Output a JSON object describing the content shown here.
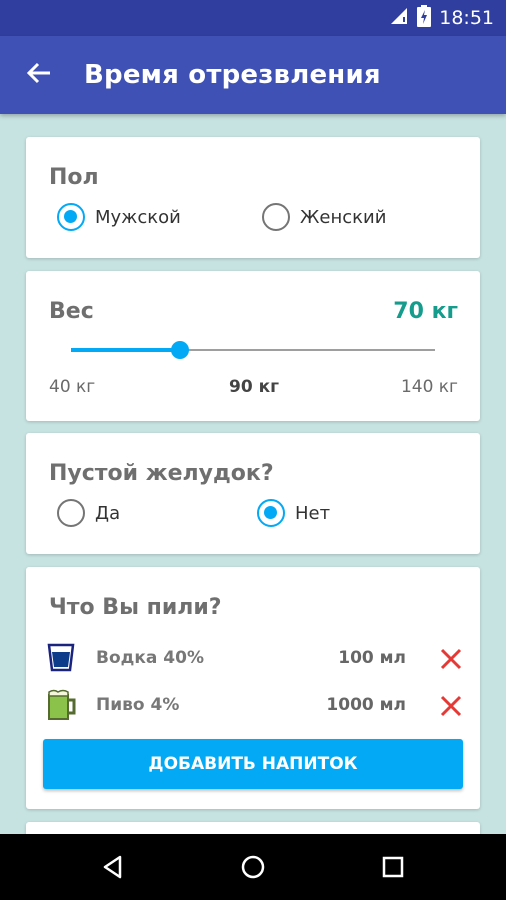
{
  "status_bar": {
    "time": "18:51"
  },
  "app_bar": {
    "title": "Время отрезвления",
    "back_icon": "arrow-back-icon"
  },
  "gender": {
    "title": "Пол",
    "options": [
      {
        "label": "Мужской",
        "checked": true
      },
      {
        "label": "Женский",
        "checked": false
      }
    ]
  },
  "weight": {
    "title": "Вес",
    "value_label": "70 кг",
    "value": 70,
    "min": 40,
    "max": 140,
    "ticks": [
      "40 кг",
      "90 кг",
      "140 кг"
    ]
  },
  "stomach": {
    "title": "Пустой желудок?",
    "options": [
      {
        "label": "Да",
        "checked": false
      },
      {
        "label": "Нет",
        "checked": true
      }
    ]
  },
  "drinks": {
    "title": "Что Вы пили?",
    "items": [
      {
        "name": "Водка 40%",
        "amount": "100 мл",
        "icon": "vodka-glass-icon"
      },
      {
        "name": "Пиво 4%",
        "amount": "1000 мл",
        "icon": "beer-mug-icon"
      }
    ],
    "add_label": "ДОБАВИТЬ НАПИТОК"
  },
  "colors": {
    "accent": "#03a9f4",
    "primary": "#3f51b5",
    "primary_dark": "#303f9f",
    "weight_value": "#159c8c",
    "remove": "#e53935"
  }
}
